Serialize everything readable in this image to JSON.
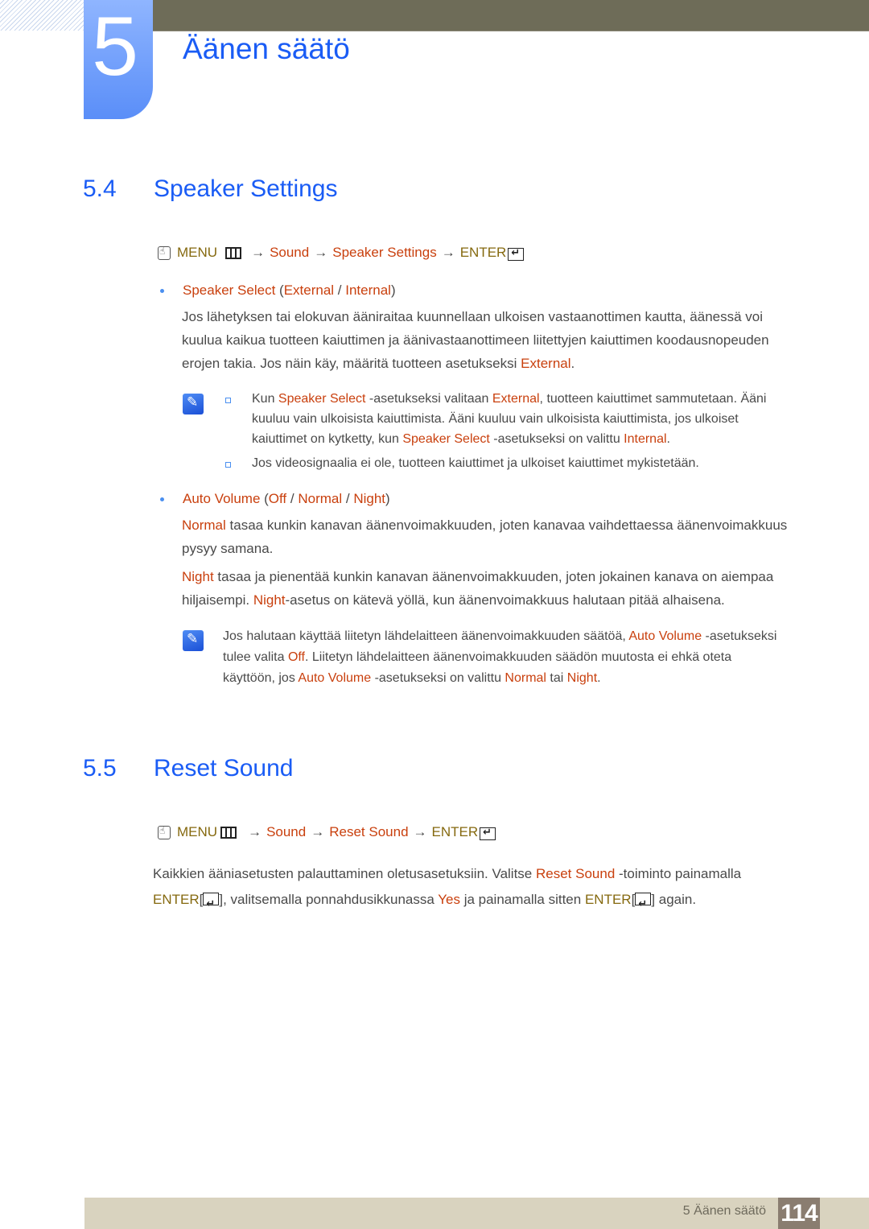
{
  "header": {
    "chapter_number": "5",
    "chapter_title": "Äänen säätö"
  },
  "section_5_4": {
    "number": "5.4",
    "title": "Speaker Settings",
    "menu_path": {
      "menu": "MENU",
      "steps": [
        "Sound",
        "Speaker Settings"
      ],
      "enter": "ENTER",
      "arrow": "→"
    },
    "speaker_select": {
      "label": "Speaker Select",
      "open": " (",
      "opt1": "External",
      "sep": " / ",
      "opt2": "Internal",
      "close": ")",
      "description": {
        "line1": "Jos lähetyksen tai elokuvan ääniraitaa kuunnellaan ulkoisen vastaanottimen kautta, äänessä voi",
        "line2": "kuulua kaikua tuotteen kaiuttimen ja äänivastaanottimeen liitettyjen kaiuttimen koodausnopeuden",
        "line3_pre": "erojen takia. Jos näin käy, määritä tuotteen asetukseksi ",
        "line3_term": "External",
        "line3_post": "."
      },
      "notes": [
        {
          "p1": "Kun ",
          "t1": "Speaker Select",
          "p2": " -asetukseksi valitaan ",
          "t2": "External",
          "p3": ", tuotteen kaiuttimet sammutetaan. Ääni",
          "line2": "kuuluu vain ulkoisista kaiuttimista. Ääni kuuluu vain ulkoisista kaiuttimista, jos ulkoiset",
          "p4": "kaiuttimet on kytketty, kun ",
          "t3": "Speaker Select",
          "p5": " -asetukseksi on valittu ",
          "t4": "Internal",
          "p6": "."
        },
        {
          "text": "Jos videosignaalia ei ole, tuotteen kaiuttimet ja ulkoiset kaiuttimet mykistetään."
        }
      ]
    },
    "auto_volume": {
      "label": "Auto Volume",
      "open": " (",
      "opt1": "Off",
      "sep1": " / ",
      "opt2": "Normal",
      "sep2": " / ",
      "opt3": "Night",
      "close": ")",
      "normal_para": {
        "term": "Normal",
        "line1": " tasaa kunkin kanavan äänenvoimakkuuden, joten kanavaa vaihdettaessa äänenvoimakkuus",
        "line2": "pysyy samana."
      },
      "night_para": {
        "term": "Night",
        "line1": " tasaa ja pienentää kunkin kanavan äänenvoimakkuuden, joten jokainen kanava on aiempaa",
        "line2_pre": "hiljaisempi. ",
        "line2_term": "Night",
        "line2_post": "-asetus on kätevä yöllä, kun äänenvoimakkuus halutaan pitää alhaisena."
      },
      "note": {
        "p1": "Jos halutaan käyttää liitetyn lähdelaitteen äänenvoimakkuuden säätöä, ",
        "t1": "Auto Volume",
        "p2": " -asetukseksi",
        "p3": "tulee valita ",
        "t2": "Off",
        "p4": ". Liitetyn lähdelaitteen äänenvoimakkuuden säädön muutosta ei ehkä oteta",
        "p5": "käyttöön, jos ",
        "t3": "Auto Volume",
        "p6": " -asetukseksi on valittu ",
        "t4": "Normal",
        "p7": " tai ",
        "t5": "Night",
        "p8": "."
      }
    }
  },
  "section_5_5": {
    "number": "5.5",
    "title": "Reset Sound",
    "menu_path": {
      "menu": "MENU",
      "steps": [
        "Sound",
        "Reset Sound"
      ],
      "enter": "ENTER",
      "arrow": "→"
    },
    "body": {
      "p1": "Kaikkien ääniasetusten palauttaminen oletusasetuksiin. Valitse ",
      "t1": "Reset Sound",
      "p2": " -toiminto painamalla",
      "k1": "ENTER",
      "b_open": "[",
      "b_close": "]",
      "p3": ", valitsemalla ponnahdusikkunassa ",
      "t2": "Yes",
      "p4": " ja painamalla sitten ",
      "k2": "ENTER",
      "p5": " again."
    }
  },
  "footer": {
    "label": "5 Äänen säätö",
    "page_number": "114"
  },
  "colors": {
    "heading_blue": "#1a5cf5",
    "term_orange": "#c9400e",
    "keyword_gold": "#85690f",
    "top_bar": "#6e6c58",
    "footer_bar": "#d9d3bf",
    "page_box": "#8a7d70"
  }
}
